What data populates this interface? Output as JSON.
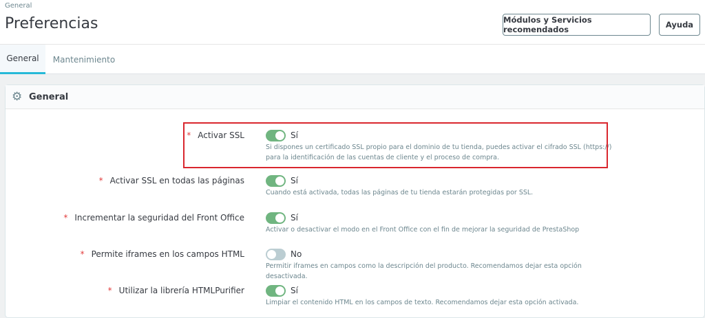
{
  "header": {
    "breadcrumb": "General",
    "title": "Preferencias",
    "buttons": [
      "Módulos y Servicios recomendados",
      "Ayuda"
    ]
  },
  "tabs": [
    "General",
    "Mantenimiento"
  ],
  "panel": {
    "title": "General",
    "icon": "gear-icon",
    "rows": [
      {
        "label": "Activar SSL",
        "value": "Sí",
        "on": true,
        "help": "Si dispones un certificado SSL propio para el dominio de tu tienda, puedes activar el cifrado SSL (https://) para la identificación de las cuentas de cliente y el proceso de compra."
      },
      {
        "label": "Activar SSL en todas las páginas",
        "value": "Sí",
        "on": true,
        "help": "Cuando está activada, todas las páginas de tu tienda estarán protegidas por SSL."
      },
      {
        "label": "Incrementar la seguridad del Front Office",
        "value": "Sí",
        "on": true,
        "help": "Activar o desactivar el modo en el Front Office con el fin de mejorar la seguridad de PrestaShop"
      },
      {
        "label": "Permite iframes en los campos HTML",
        "value": "No",
        "on": false,
        "help": "Permitir iframes en campos como la descripción del producto. Recomendamos dejar esta opción desactivada."
      },
      {
        "label": "Utilizar la librería HTMLPurifier",
        "value": "Sí",
        "on": true,
        "help": "Limpiar el contenido HTML en los campos de texto. Recomendamos dejar esta opción activada."
      }
    ]
  },
  "required_mark": "*"
}
